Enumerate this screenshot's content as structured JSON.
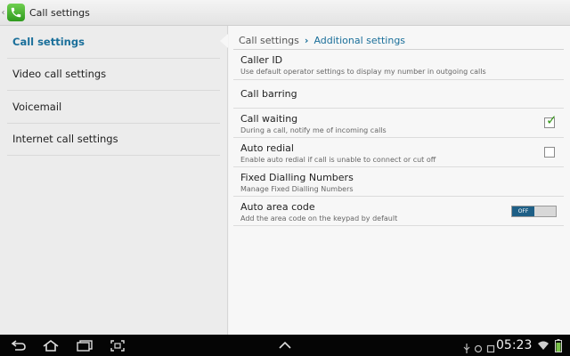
{
  "actionbar": {
    "title": "Call settings"
  },
  "sidebar": {
    "items": [
      {
        "label": "Call settings",
        "active": true
      },
      {
        "label": "Video call settings"
      },
      {
        "label": "Voicemail"
      },
      {
        "label": "Internet call settings"
      }
    ]
  },
  "breadcrumb": {
    "parent": "Call settings",
    "separator": "›",
    "current": "Additional settings"
  },
  "settings": [
    {
      "title": "Caller ID",
      "summary": "Use default operator settings to display my number in outgoing calls"
    },
    {
      "title": "Call barring"
    },
    {
      "title": "Call waiting",
      "summary": "During a call, notify me of incoming calls",
      "checked": true
    },
    {
      "title": "Auto redial",
      "summary": "Enable auto redial if call is unable to connect or cut off",
      "checked": false
    },
    {
      "title": "Fixed Dialling Numbers",
      "summary": "Manage Fixed Dialling Numbers"
    },
    {
      "title": "Auto area code",
      "summary": "Add the area code on the keypad by default",
      "toggle": "OFF"
    }
  ],
  "statusbar": {
    "time": "05:23"
  },
  "colors": {
    "accent": "#1a6f9a",
    "check_green": "#3a9a1e",
    "toggle_off": "#1e5f86"
  },
  "icons": [
    "phone-icon",
    "back-icon",
    "home-icon",
    "recent-apps-icon",
    "screenshot-icon",
    "up-arrow-icon",
    "usb-icon",
    "wifi-icon",
    "battery-icon"
  ]
}
